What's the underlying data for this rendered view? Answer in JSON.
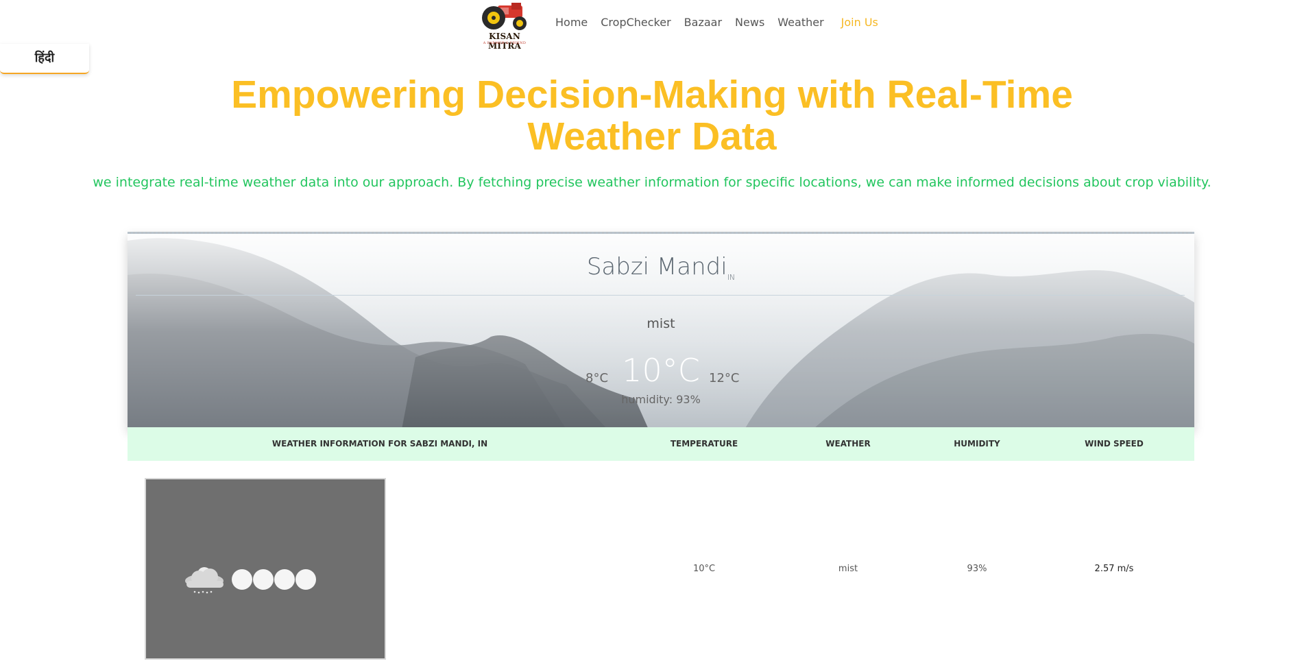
{
  "nav": {
    "logo_text": "KISAN MITRA",
    "logo_sub": "A FARMER'S FRIEND",
    "links": [
      "Home",
      "CropChecker",
      "Bazaar",
      "News",
      "Weather"
    ],
    "join": "Join Us"
  },
  "lang_button": "हिंदी",
  "hero": {
    "title_line1": "Empowering Decision-Making with Real-Time",
    "title_line2": "Weather Data",
    "subtitle": "we integrate real-time weather data into our approach. By fetching precise weather information for specific locations, we can make informed decisions about crop viability."
  },
  "card": {
    "city": "Sabzi Mandi",
    "country": "IN",
    "description": "mist",
    "temp_min": "8°C",
    "temp": "10°C",
    "temp_max": "12°C",
    "humidity": "humidity: 93%"
  },
  "table": {
    "headers": {
      "info": "WEATHER INFORMATION FOR SABZI MANDI, IN",
      "temperature": "TEMPERATURE",
      "weather": "WEATHER",
      "humidity": "HUMIDITY",
      "wind": "WIND SPEED"
    },
    "row": {
      "icon": "rain-cloud-icon",
      "temperature": "10°C",
      "weather": "mist",
      "humidity": "93%",
      "wind": "2.57 m/s"
    }
  },
  "colors": {
    "accent": "#fbbf24",
    "subtitle": "#22c55e",
    "table_header_bg": "#dcfce7"
  }
}
